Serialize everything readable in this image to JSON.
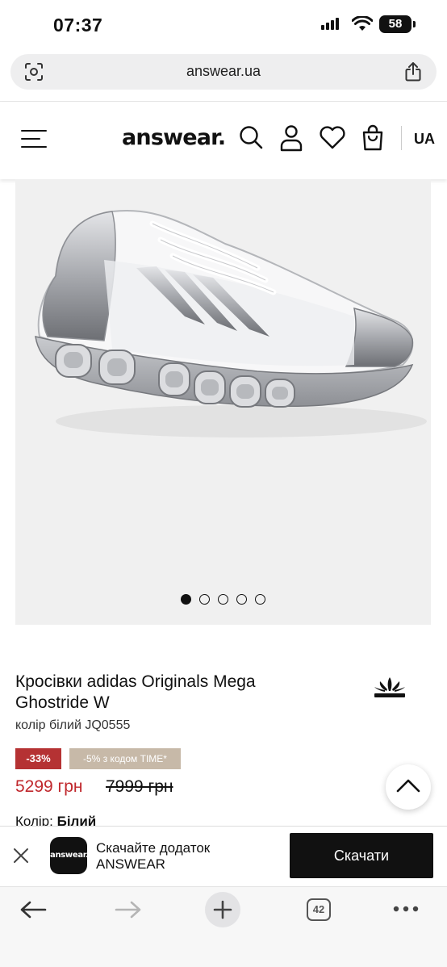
{
  "status_bar": {
    "time": "07:37",
    "battery": "58"
  },
  "browser": {
    "url": "answear.ua",
    "tab_count": "42"
  },
  "header": {
    "logo": "answear.",
    "language": "UA"
  },
  "product": {
    "title": "Кросівки adidas Originals Mega Ghostride W",
    "color_code": "колір білий JQ0555",
    "discount_badge": "-33%",
    "promo_badge": "-5% з кодом TIME*",
    "price_new": "5299 грн",
    "price_old": "7999 грн",
    "color_label": "Колір: ",
    "color_value": "Білий",
    "image_dots": 5,
    "active_image": 1
  },
  "app_banner": {
    "icon_text": "answear.",
    "line1": "Скачайте додаток",
    "line2": "ANSWEAR",
    "button": "Скачати"
  },
  "colors": {
    "sale_red": "#b53233",
    "promo_beige": "#c7b9a8",
    "price_red": "#c0282d"
  },
  "icons": [
    "screenshot-icon",
    "share-icon",
    "menu-icon",
    "search-icon",
    "account-icon",
    "wishlist-icon",
    "cart-icon",
    "adidas-logo-icon",
    "chevron-up-icon",
    "close-icon",
    "back-icon",
    "forward-icon",
    "new-tab-icon",
    "more-icon"
  ]
}
